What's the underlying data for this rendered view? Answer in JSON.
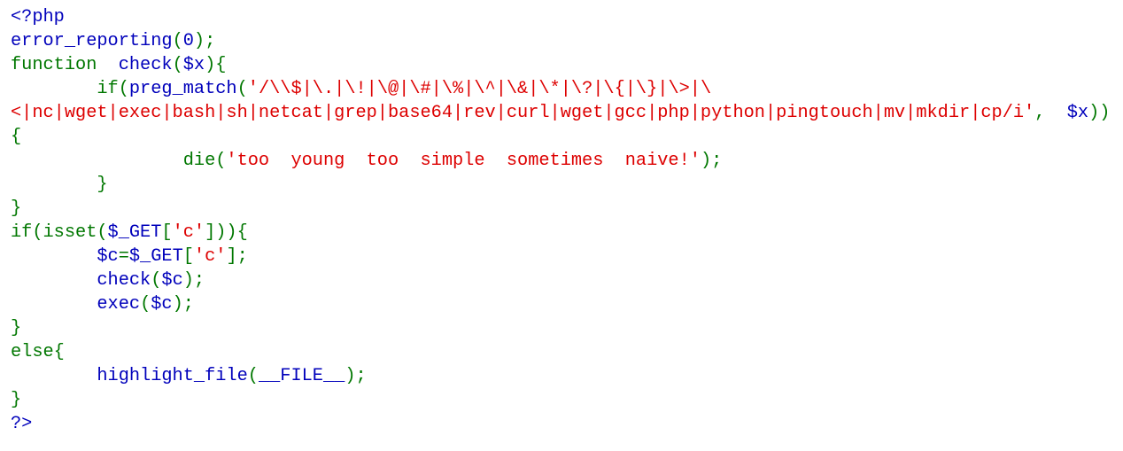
{
  "colors": {
    "b": "#0000BB",
    "g": "#007700",
    "r": "#DD0000"
  },
  "code_lines": [
    [
      [
        "b",
        "<?php"
      ]
    ],
    [
      [
        "b",
        "error_reporting"
      ],
      [
        "g",
        "("
      ],
      [
        "b",
        "0"
      ],
      [
        "g",
        ");"
      ]
    ],
    [
      [
        "g",
        "function"
      ],
      [
        "b",
        "  check"
      ],
      [
        "g",
        "("
      ],
      [
        "b",
        "$x"
      ],
      [
        "g",
        "){"
      ]
    ],
    [
      [
        "g",
        "        if("
      ],
      [
        "b",
        "preg_match"
      ],
      [
        "g",
        "("
      ],
      [
        "r",
        "'/\\\\$|\\.|\\!|\\@|\\#|\\%|\\^|\\&|\\*|\\?|\\{|\\}|\\>|\\"
      ]
    ],
    [
      [
        "r",
        "<|nc|wget|exec|bash|sh|netcat|grep|base64|rev|curl|wget|gcc|php|python|pingtouch|mv|mkdir|cp/i'"
      ],
      [
        "g",
        ",  "
      ],
      [
        "b",
        "$x"
      ],
      [
        "g",
        "))"
      ]
    ],
    [
      [
        "g",
        "{"
      ]
    ],
    [
      [
        "g",
        "                die("
      ],
      [
        "r",
        "'too  young  too  simple  sometimes  naive!'"
      ],
      [
        "g",
        ");"
      ]
    ],
    [
      [
        "g",
        "        }"
      ]
    ],
    [
      [
        "g",
        "}"
      ]
    ],
    [
      [
        "g",
        "if(isset("
      ],
      [
        "b",
        "$_GET"
      ],
      [
        "g",
        "["
      ],
      [
        "r",
        "'c'"
      ],
      [
        "g",
        "])){"
      ]
    ],
    [
      [
        "b",
        "        $c"
      ],
      [
        "g",
        "="
      ],
      [
        "b",
        "$_GET"
      ],
      [
        "g",
        "["
      ],
      [
        "r",
        "'c'"
      ],
      [
        "g",
        "];"
      ]
    ],
    [
      [
        "b",
        "        check"
      ],
      [
        "g",
        "("
      ],
      [
        "b",
        "$c"
      ],
      [
        "g",
        ");"
      ]
    ],
    [
      [
        "b",
        "        exec"
      ],
      [
        "g",
        "("
      ],
      [
        "b",
        "$c"
      ],
      [
        "g",
        ");"
      ]
    ],
    [
      [
        "g",
        "}"
      ]
    ],
    [
      [
        "g",
        "else{"
      ]
    ],
    [
      [
        "b",
        "        highlight_file"
      ],
      [
        "g",
        "("
      ],
      [
        "b",
        "__FILE__"
      ],
      [
        "g",
        ");"
      ]
    ],
    [
      [
        "g",
        "}"
      ]
    ],
    [
      [
        "b",
        "?>"
      ]
    ]
  ]
}
